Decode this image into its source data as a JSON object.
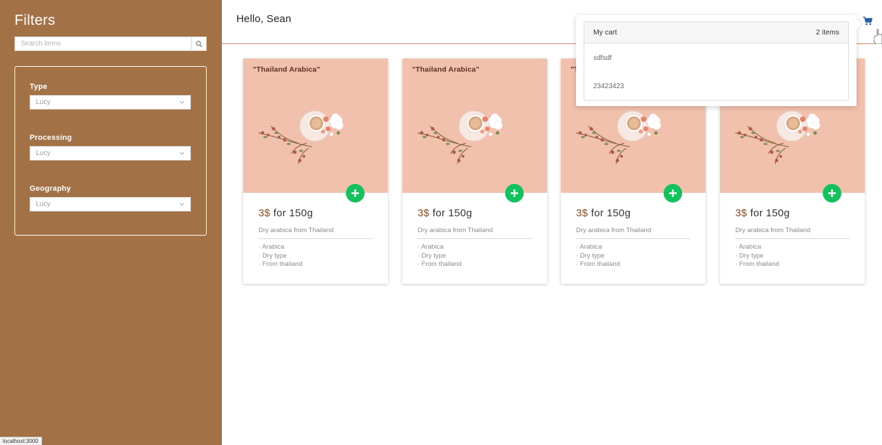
{
  "sidebar": {
    "title": "Filters",
    "search": {
      "placeholder": "Search items",
      "icon": "search-icon"
    },
    "filters": [
      {
        "label": "Type",
        "value": "Lucy"
      },
      {
        "label": "Processing",
        "value": "Lucy"
      },
      {
        "label": "Geography",
        "value": "Lucy"
      }
    ]
  },
  "status_url": "localhost:3000",
  "header": {
    "greeting": "Hello, Sean",
    "cart_icon": "shopping-cart-icon"
  },
  "products": [
    {
      "image_title": "\"Thailand Arabica\"",
      "price_currency": "3$",
      "price_rest": " for 150g",
      "description": "Dry arabica from Thailand",
      "features": [
        "· Arabica",
        "· Dry type",
        "· From thailand"
      ]
    },
    {
      "image_title": "\"Thailand Arabica\"",
      "price_currency": "3$",
      "price_rest": " for 150g",
      "description": "Dry arabica from Thailand",
      "features": [
        "· Arabica",
        "· Dry type",
        "· From thailand"
      ]
    },
    {
      "image_title": "\"T",
      "price_currency": "3$",
      "price_rest": " for 150g",
      "description": "Dry arabica from Thailand",
      "features": [
        "· Arabica",
        "· Dry type",
        "· From thailand"
      ]
    },
    {
      "image_title": "",
      "price_currency": "3$",
      "price_rest": " for 150g",
      "description": "Dry arabica from Thailand",
      "features": [
        "· Arabica",
        "· Dry type",
        "· From thailand"
      ]
    }
  ],
  "cart": {
    "title": "My cart",
    "count_label": "2 items",
    "items": [
      "sdfsdf",
      "23423423"
    ]
  },
  "colors": {
    "sidebar_bg": "#a37146",
    "accent_green": "#13c15d",
    "cart_icon": "#1f5fa8",
    "card_image_bg": "#f2c1ae"
  }
}
